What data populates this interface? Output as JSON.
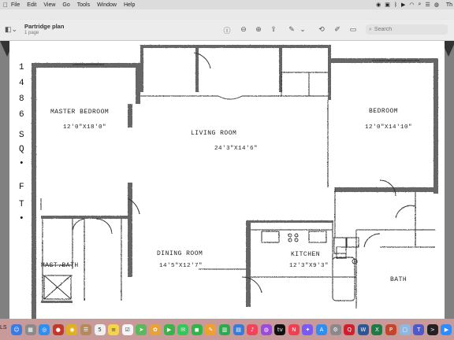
{
  "menubar": {
    "apple": "",
    "items": [
      "File",
      "Edit",
      "View",
      "Go",
      "Tools",
      "Window",
      "Help"
    ],
    "clock": "Th"
  },
  "toolbar": {
    "title": "Partridge plan",
    "subtitle": "1 page",
    "search_placeholder": "Search"
  },
  "plan": {
    "side_text": [
      "1",
      "4",
      "8",
      "6",
      "S",
      "Q",
      "•",
      "F",
      "T",
      "•"
    ],
    "rooms": {
      "master_bedroom": {
        "name": "MASTER BEDROOM",
        "dims": "12'0\"X18'0\""
      },
      "living_room": {
        "name": "LIVING ROOM",
        "dims": "24'3\"X14'6\""
      },
      "bedroom": {
        "name": "BEDROOM",
        "dims": "12'0\"X14'10\""
      },
      "dining_room": {
        "name": "DINING ROOM",
        "dims": "14'5\"X12'7\""
      },
      "kitchen": {
        "name": "KITCHEN",
        "dims": "12'3\"X9'3\""
      },
      "mast_bath": {
        "name": "MAST.BATH"
      },
      "bath": {
        "name": "BATH"
      }
    }
  },
  "dock": {
    "left_text": "LS",
    "icons": [
      {
        "name": "finder",
        "color": "#3c7be0",
        "glyph": "☺"
      },
      {
        "name": "launchpad",
        "color": "#8a8a8a",
        "glyph": "▦"
      },
      {
        "name": "safari",
        "color": "#2f8ef0",
        "glyph": "◎"
      },
      {
        "name": "photo-booth",
        "color": "#c0392b",
        "glyph": "●"
      },
      {
        "name": "chrome",
        "color": "#e0b020",
        "glyph": "◉"
      },
      {
        "name": "contacts",
        "color": "#b58a5a",
        "glyph": "☰"
      },
      {
        "name": "calendar",
        "color": "#f0f0f0",
        "glyph": "5"
      },
      {
        "name": "notes",
        "color": "#f5d44a",
        "glyph": "≡"
      },
      {
        "name": "reminders",
        "color": "#f5f5f5",
        "glyph": "☑"
      },
      {
        "name": "maps",
        "color": "#5cb85c",
        "glyph": "➤"
      },
      {
        "name": "photos",
        "color": "#e8a23a",
        "glyph": "✿"
      },
      {
        "name": "facetime",
        "color": "#3bb34a",
        "glyph": "▶"
      },
      {
        "name": "messages",
        "color": "#35c759",
        "glyph": "✉"
      },
      {
        "name": "facetime-2",
        "color": "#34b34a",
        "glyph": "◼"
      },
      {
        "name": "pages",
        "color": "#f0a030",
        "glyph": "✎"
      },
      {
        "name": "numbers",
        "color": "#2fa84f",
        "glyph": "▥"
      },
      {
        "name": "keynote",
        "color": "#3a7bd5",
        "glyph": "▤"
      },
      {
        "name": "music",
        "color": "#f3435b",
        "glyph": "♪"
      },
      {
        "name": "podcasts",
        "color": "#9b4dd6",
        "glyph": "◍"
      },
      {
        "name": "tv",
        "color": "#111111",
        "glyph": "tv"
      },
      {
        "name": "news",
        "color": "#f04050",
        "glyph": "N"
      },
      {
        "name": "messenger",
        "color": "#7a5af5",
        "glyph": "✦"
      },
      {
        "name": "app-store",
        "color": "#2f8ef0",
        "glyph": "A"
      },
      {
        "name": "system-preferences",
        "color": "#8a8a8a",
        "glyph": "⚙"
      },
      {
        "name": "quicken",
        "color": "#d02030",
        "glyph": "Q"
      },
      {
        "name": "word",
        "color": "#2b5797",
        "glyph": "W"
      },
      {
        "name": "excel",
        "color": "#1f7a45",
        "glyph": "X"
      },
      {
        "name": "powerpoint",
        "color": "#c4462a",
        "glyph": "P"
      },
      {
        "name": "preview",
        "color": "#8fb8e0",
        "glyph": "▢"
      },
      {
        "name": "teams",
        "color": "#5059c9",
        "glyph": "T"
      },
      {
        "name": "terminal",
        "color": "#222222",
        "glyph": ">"
      },
      {
        "name": "zoom",
        "color": "#2d8cff",
        "glyph": "▶"
      },
      {
        "name": "acrobat",
        "color": "#d32f2f",
        "glyph": "A"
      }
    ]
  }
}
